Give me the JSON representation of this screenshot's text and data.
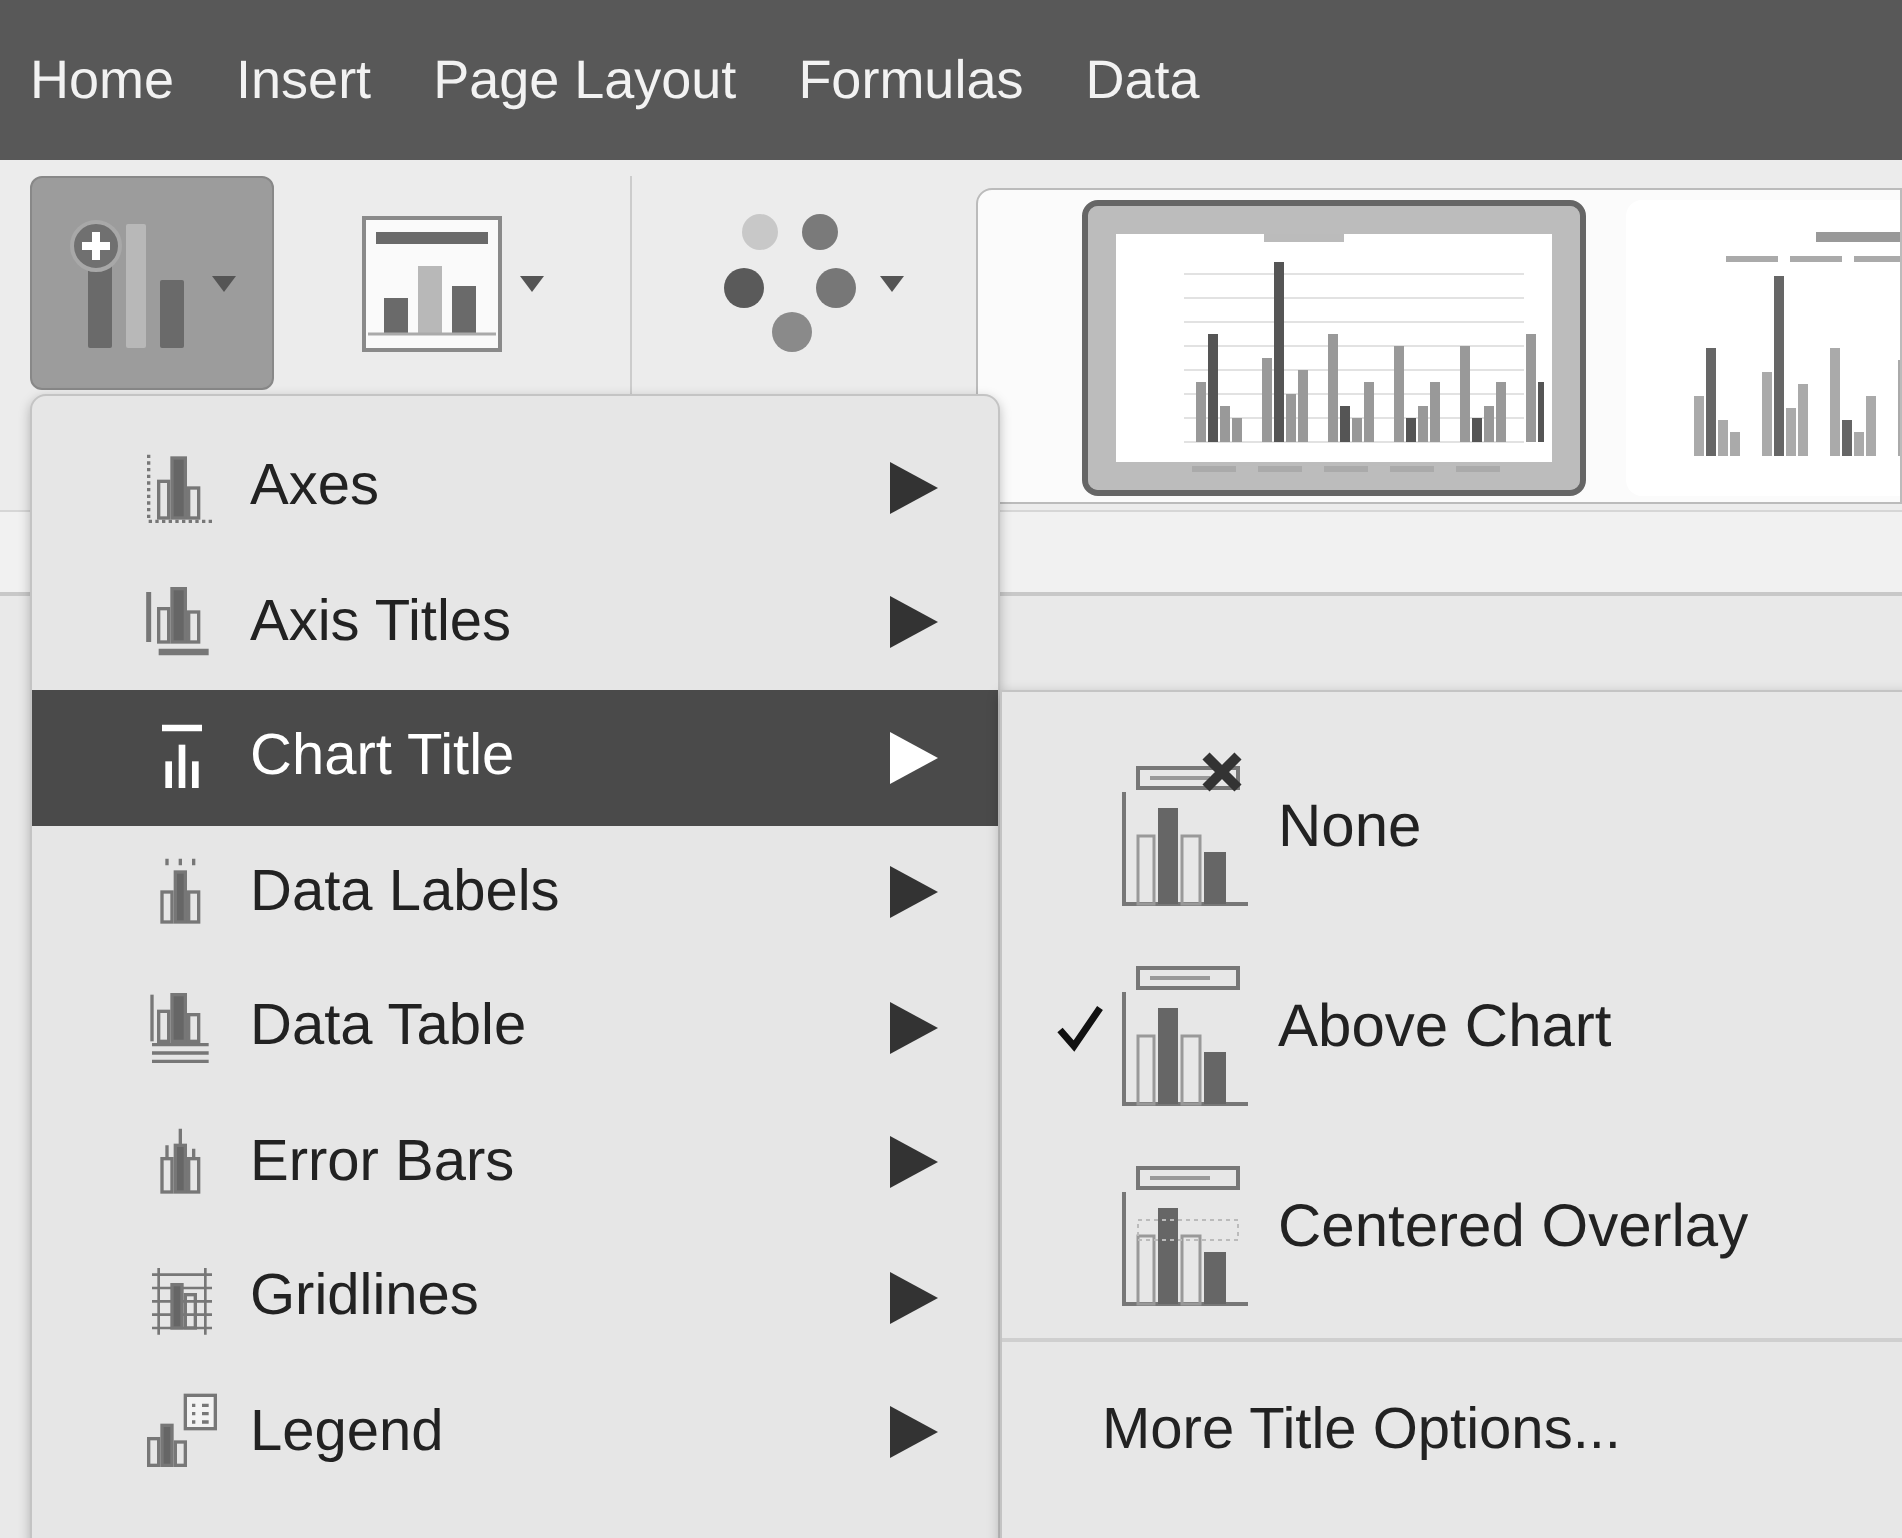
{
  "tabs": [
    {
      "label": "Home"
    },
    {
      "label": "Insert"
    },
    {
      "label": "Page Layout"
    },
    {
      "label": "Formulas"
    },
    {
      "label": "Data"
    }
  ],
  "ribbon": {
    "buttons": [
      {
        "kind": "add-element",
        "open": true
      },
      {
        "kind": "quick-layout",
        "open": false
      },
      {
        "kind": "colors",
        "open": false
      }
    ],
    "style_gallery": [
      {
        "kind": "plain",
        "selected": true
      },
      {
        "kind": "labeled",
        "selected": false
      }
    ]
  },
  "menu": {
    "items": [
      {
        "label": "Axes",
        "kind": "axes",
        "selected": false
      },
      {
        "label": "Axis Titles",
        "kind": "axis-titles",
        "selected": false
      },
      {
        "label": "Chart Title",
        "kind": "chart-title",
        "selected": true
      },
      {
        "label": "Data Labels",
        "kind": "data-labels",
        "selected": false
      },
      {
        "label": "Data Table",
        "kind": "data-table",
        "selected": false
      },
      {
        "label": "Error Bars",
        "kind": "error-bars",
        "selected": false
      },
      {
        "label": "Gridlines",
        "kind": "gridlines",
        "selected": false
      },
      {
        "label": "Legend",
        "kind": "legend",
        "selected": false
      }
    ]
  },
  "submenu": {
    "options": [
      {
        "label": "None",
        "kind": "none",
        "checked": false
      },
      {
        "label": "Above Chart",
        "kind": "above",
        "checked": true
      },
      {
        "label": "Centered Overlay",
        "kind": "overlay",
        "checked": false
      }
    ],
    "more": "More Title Options..."
  }
}
